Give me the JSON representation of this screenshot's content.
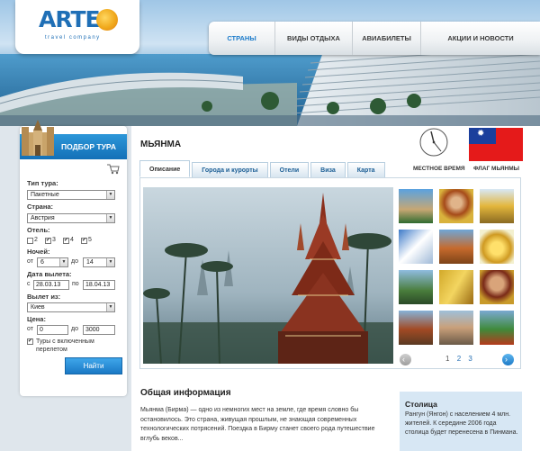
{
  "header": {
    "logo_text": "ARTE",
    "logo_sub": "travel company",
    "nav": [
      {
        "label": "СТРАНЫ",
        "active": true
      },
      {
        "label": "ВИДЫ ОТДЫХА",
        "active": false
      },
      {
        "label": "АВИАБИЛЕТЫ",
        "active": false
      },
      {
        "label": "АКЦИИ И НОВОСТИ",
        "active": false
      }
    ]
  },
  "sidebar": {
    "title": "ПОДБОР ТУРА",
    "tour_type_label": "Тип тура:",
    "tour_type_value": "Пакетные",
    "country_label": "Страна:",
    "country_value": "Австрия",
    "hotel_label": "Отель:",
    "hotel_stars": [
      {
        "label": "2",
        "checked": false
      },
      {
        "label": "3",
        "checked": true
      },
      {
        "label": "4",
        "checked": true
      },
      {
        "label": "5",
        "checked": true
      }
    ],
    "nights_label": "Ночей:",
    "nights_from_prefix": "от",
    "nights_from": "6",
    "nights_to_prefix": "до",
    "nights_to": "14",
    "date_label": "Дата вылета:",
    "date_from_prefix": "с",
    "date_from": "28.03.13",
    "date_to_prefix": "по",
    "date_to": "18.04.13",
    "departure_label": "Вылет из:",
    "departure_value": "Киев",
    "price_label": "Цена:",
    "price_from_prefix": "от",
    "price_from": "0",
    "price_to_prefix": "до",
    "price_to": "3000",
    "flight_included_label": "Туры с включенным перелетом",
    "flight_included": true,
    "search_button": "Найти"
  },
  "main": {
    "country_title": "МЬЯНМА",
    "local_time_label": "МЕСТНОЕ ВРЕМЯ",
    "flag_label": "ФЛАГ МЬЯНМЫ",
    "tabs": [
      {
        "label": "Описание",
        "active": true
      },
      {
        "label": "Города и курорты",
        "active": false
      },
      {
        "label": "Отели",
        "active": false
      },
      {
        "label": "Виза",
        "active": false
      },
      {
        "label": "Карта",
        "active": false
      }
    ],
    "pages": [
      "1",
      "2",
      "3"
    ],
    "current_page": "1",
    "info_title": "Общая информация",
    "info_text": "Мьянма (Бирма) — одно из немногих мест на земле, где время словно бы остановилось. Это страна, живущая прошлым, не знающая современных технологических потрясений. Поездка в Бирму станет своего рода путешествие вглубь веков...",
    "capital_title": "Столица",
    "capital_text": "Рангун (Янгон) с населением 4 млн. жителей. К середине 2006 года столица будет перенесена в Пинмана."
  },
  "colors": {
    "accent": "#1d7ccb",
    "nav_bg": "#eef1f3",
    "sidebar_header": "#1470b7",
    "flag_red": "#e51a1a",
    "flag_blue": "#1b3f9c",
    "capital_box": "#d7e7f4"
  },
  "icons": {
    "cart": "cart-icon",
    "clock": "clock-icon",
    "castle": "castle-icon",
    "prev": "arrow-left-icon",
    "next": "arrow-right-icon"
  }
}
